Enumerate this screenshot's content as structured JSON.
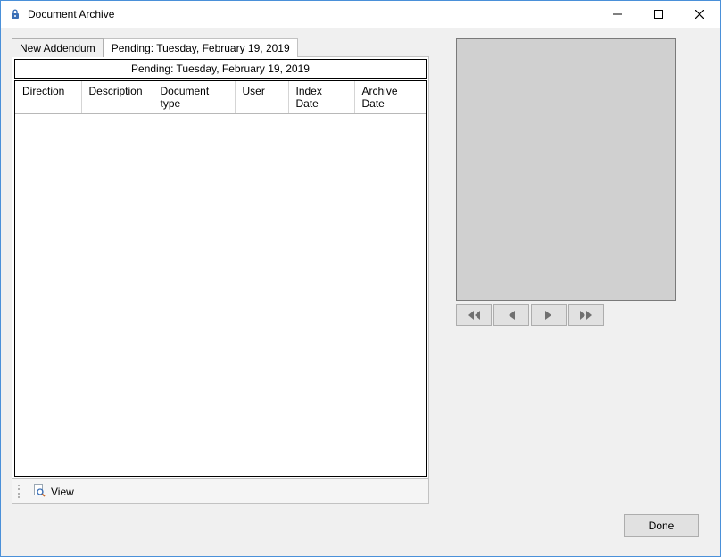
{
  "window": {
    "title": "Document Archive"
  },
  "tabs": {
    "tab0": "New Addendum",
    "tab1": "Pending: Tuesday, February 19, 2019",
    "activeIndex": 1
  },
  "panel": {
    "caption": "Pending: Tuesday, February 19, 2019"
  },
  "table": {
    "columns": {
      "c0": "Direction",
      "c1": "Description",
      "c2": "Document type",
      "c3": "User",
      "c4": "Index Date",
      "c5": "Archive Date"
    },
    "rows": []
  },
  "toolbar": {
    "view_label": "View"
  },
  "preview_nav": {
    "first_icon": "double-chevron-left-icon",
    "prev_icon": "chevron-left-icon",
    "next_icon": "chevron-right-icon",
    "last_icon": "double-chevron-right-icon"
  },
  "footer": {
    "done_label": "Done"
  }
}
